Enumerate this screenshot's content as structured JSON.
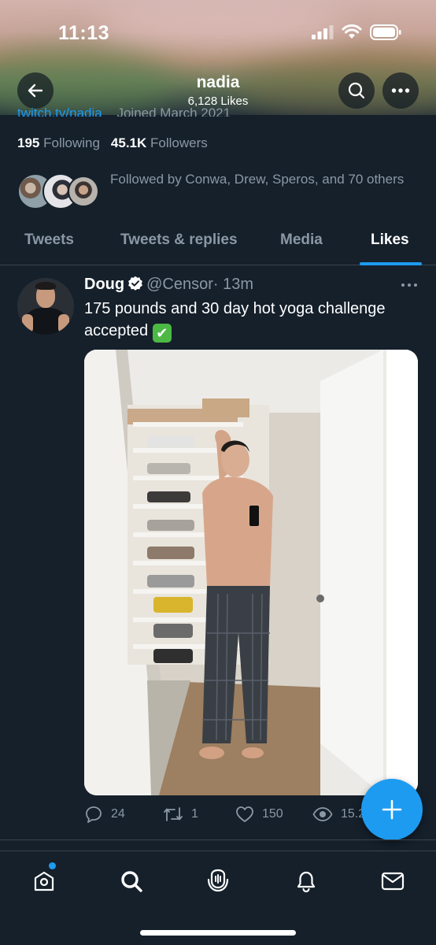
{
  "status_bar": {
    "time": "11:13"
  },
  "header": {
    "title": "nadia",
    "subtitle": "6,128 Likes",
    "peek_link": "twitch.tv/nadia",
    "peek_joined": "Joined March 2021"
  },
  "profile": {
    "following_count": "195",
    "following_label": "Following",
    "followers_count": "45.1K",
    "followers_label": "Followers",
    "followed_by_text": "Followed by Conwa, Drew, Speros, and 70 others"
  },
  "tabs": [
    {
      "label": "Tweets",
      "active": false
    },
    {
      "label": "Tweets & replies",
      "active": false
    },
    {
      "label": "Media",
      "active": false
    },
    {
      "label": "Likes",
      "active": true
    }
  ],
  "tweet": {
    "author": "Doug",
    "handle": "@Censor",
    "time": "· 13m",
    "text": "175 pounds and 30 day hot yoga challenge accepted",
    "emoji": "✔",
    "replies": "24",
    "retweets": "1",
    "likes": "150",
    "views": "15.2K"
  },
  "icons": {
    "back": "arrow-left-icon",
    "search": "search-icon",
    "more": "more-horizontal-icon",
    "verified": "verified-badge-icon",
    "compose": "plus-icon"
  },
  "colors": {
    "background": "#15202b",
    "accent": "#1d9bf0",
    "secondary_text": "#8b98a5",
    "divider": "#38444d"
  }
}
